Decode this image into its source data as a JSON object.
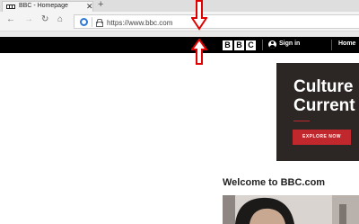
{
  "browser": {
    "tab_title": "BBC - Homepage",
    "tab_close": "✕",
    "new_tab": "+",
    "back": "←",
    "forward": "→",
    "reload": "↻",
    "home": "⌂",
    "url": "https://www.bbc.com"
  },
  "bbc_header": {
    "logo_letters": [
      "B",
      "B",
      "C"
    ],
    "signin_label": "Sign in",
    "home_label": "Home"
  },
  "hero": {
    "title_line1": "Culture",
    "title_line2": "Current",
    "button_label": "EXPLORE NOW"
  },
  "welcome_heading": "Welcome to BBC.com",
  "colors": {
    "annotation_arrow": "#e00000",
    "bbc_red": "#c0282d"
  }
}
